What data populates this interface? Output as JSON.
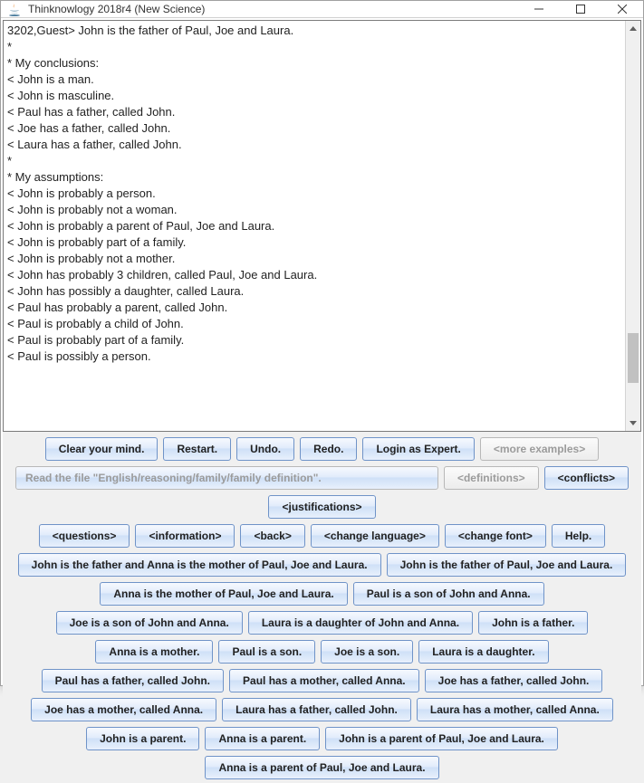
{
  "window": {
    "title": "Thinknowlogy 2018r4 (New Science)"
  },
  "output": {
    "lines": [
      "3202,Guest> John is the father of Paul, Joe and Laura.",
      "*",
      "* My conclusions:",
      "< John is a man.",
      "< John is masculine.",
      "< Paul has a father, called John.",
      "< Joe has a father, called John.",
      "< Laura has a father, called John.",
      "*",
      "* My assumptions:",
      "< John is probably a person.",
      "< John is probably not a woman.",
      "< John is probably a parent of Paul, Joe and Laura.",
      "< John is probably part of a family.",
      "< John is probably not a mother.",
      "< John has probably 3 children, called Paul, Joe and Laura.",
      "< John has possibly a daughter, called Laura.",
      "< Paul has probably a parent, called John.",
      "< Paul is probably a child of John.",
      "< Paul is probably part of a family.",
      "< Paul is possibly a person."
    ]
  },
  "toolbar1": {
    "clear": "Clear your mind.",
    "restart": "Restart.",
    "undo": "Undo.",
    "redo": "Redo.",
    "login": "Login as Expert.",
    "more": "<more examples>"
  },
  "toolbar2": {
    "readfile": "Read the file \"English/reasoning/family/family definition\".",
    "definitions": "<definitions>",
    "conflicts": "<conflicts>",
    "justifications": "<justifications>"
  },
  "toolbar3": {
    "questions": "<questions>",
    "information": "<information>",
    "back": "<back>",
    "change_language": "<change language>",
    "change_font": "<change font>",
    "help": "Help."
  },
  "sentences": [
    "John is the father and Anna is the mother of Paul, Joe and Laura.",
    "John is the father of Paul, Joe and Laura.",
    "Anna is the mother of Paul, Joe and Laura.",
    "Paul is a son of John and Anna.",
    "Joe is a son of John and Anna.",
    "Laura is a daughter of John and Anna.",
    "John is a father.",
    "Anna is a mother.",
    "Paul is a son.",
    "Joe is a son.",
    "Laura is a daughter.",
    "Paul has a father, called John.",
    "Paul has a mother, called Anna.",
    "Joe has a father, called John.",
    "Joe has a mother, called Anna.",
    "Laura has a father, called John.",
    "Laura has a mother, called Anna.",
    "John is a parent.",
    "Anna is a parent.",
    "John is a parent of Paul, Joe and Laura.",
    "Anna is a parent of Paul, Joe and Laura."
  ]
}
